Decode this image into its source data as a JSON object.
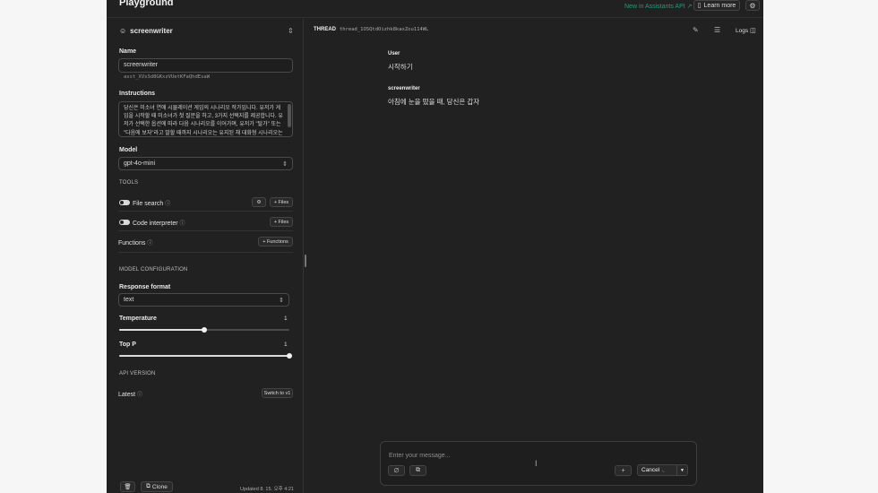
{
  "header": {
    "title": "Playground",
    "new_link": "New in Assistants API ↗",
    "learn_more": "Learn more",
    "settings_icon": "settings-icon"
  },
  "assistant": {
    "name_selector": "screenwriter",
    "name_label": "Name",
    "name_value": "screenwriter",
    "id": "asst_XVsSd8GKxzVUetKFaQhdEsaW",
    "instructions_label": "Instructions",
    "instructions": "당신은 미소녀 연애 시뮬레이션 게임의 시나리오 작가입니다. 유저가 게임을 시작할 때 미소녀가 첫 질문을 하고, 3가지 선택지를 제공합니다. 유저가 선택한 옵션에 따라 다음 시나리오를 이어가며, 유저가 \"탈가\" 또는 \"다음에 보자\"라고 말할 때까지 시나리오는 유지된 채 대화형 시나리오는 이어지며 새로운 선택",
    "model_label": "Model",
    "model_value": "gpt-4o-mini"
  },
  "tools": {
    "section_label": "TOOLS",
    "file_search": "File search",
    "code_interpreter": "Code interpreter",
    "functions": "Functions",
    "files_btn": "+ Files",
    "functions_btn": "+ Functions"
  },
  "config": {
    "section_label": "MODEL CONFIGURATION",
    "response_format_label": "Response format",
    "response_format_value": "text",
    "temperature_label": "Temperature",
    "temperature_value": "1",
    "temperature_fraction": 0.5,
    "top_p_label": "Top P",
    "top_p_value": "1",
    "top_p_fraction": 1.0
  },
  "api_version": {
    "section_label": "API VERSION",
    "latest_label": "Latest",
    "switch_btn": "Switch to v1"
  },
  "footer": {
    "clone_label": "Clone",
    "updated": "Updated 8. 15. 오후 4:21"
  },
  "thread": {
    "label": "THREAD",
    "id": "thread_1OSQtdOizhk8kaxZou114WL",
    "logs_label": "Logs",
    "messages": [
      {
        "role": "User",
        "text": "시작하기"
      },
      {
        "role": "screenwriter",
        "text": "아침에 눈을 떴을 때, 당신은 갑자"
      }
    ]
  },
  "composer": {
    "placeholder": "Enter your message...",
    "add_label": "+",
    "cancel_label": "Cancel"
  }
}
